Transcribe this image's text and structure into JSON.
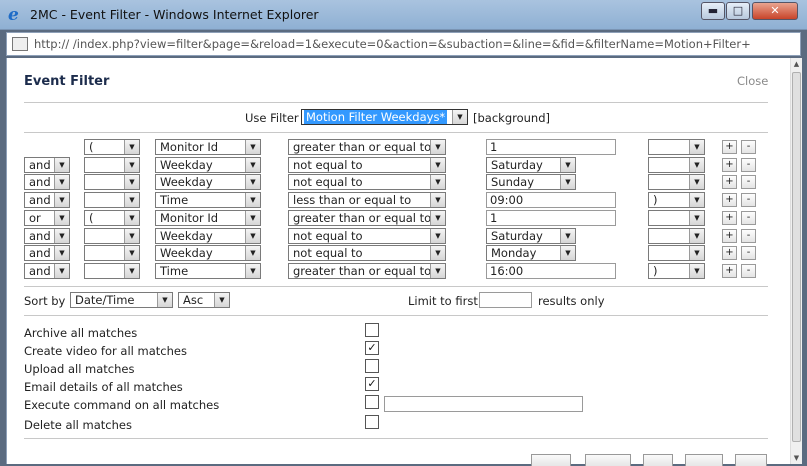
{
  "window": {
    "title": "2MC - Event Filter - Windows Internet Explorer",
    "min_glyph": "▬",
    "max_glyph": "□",
    "close_glyph": "✕",
    "url": "http://                    /index.php?view=filter&page=&reload=1&execute=0&action=&subaction=&line=&fid=&filterName=Motion+Filter+"
  },
  "header": {
    "title": "Event Filter",
    "close_label": "Close"
  },
  "use_filter": {
    "label": "Use Filter",
    "value": "Motion Filter Weekdays*",
    "background_label": "[background]"
  },
  "terms": [
    {
      "conj": "",
      "obr": "(",
      "attr": "Monitor Id",
      "op": "greater than or equal to",
      "val": "1",
      "val_type": "text",
      "cbr": ""
    },
    {
      "conj": "and",
      "obr": "",
      "attr": "Weekday",
      "op": "not equal to",
      "val": "Saturday",
      "val_type": "select",
      "cbr": ""
    },
    {
      "conj": "and",
      "obr": "",
      "attr": "Weekday",
      "op": "not equal to",
      "val": "Sunday",
      "val_type": "select",
      "cbr": ""
    },
    {
      "conj": "and",
      "obr": "",
      "attr": "Time",
      "op": "less than or equal to",
      "val": "09:00",
      "val_type": "text",
      "cbr": ")"
    },
    {
      "conj": "or",
      "obr": "(",
      "attr": "Monitor Id",
      "op": "greater than or equal to",
      "val": "1",
      "val_type": "text",
      "cbr": ""
    },
    {
      "conj": "and",
      "obr": "",
      "attr": "Weekday",
      "op": "not equal to",
      "val": "Saturday",
      "val_type": "select",
      "cbr": ""
    },
    {
      "conj": "and",
      "obr": "",
      "attr": "Weekday",
      "op": "not equal to",
      "val": "Monday",
      "val_type": "select",
      "cbr": ""
    },
    {
      "conj": "and",
      "obr": "",
      "attr": "Time",
      "op": "greater than or equal to",
      "val": "16:00",
      "val_type": "text",
      "cbr": ")"
    }
  ],
  "buttons": {
    "plus": "+",
    "minus": "-"
  },
  "sort": {
    "label": "Sort by",
    "field": "Date/Time",
    "direction": "Asc",
    "limit_label": "Limit to first",
    "limit_value": "",
    "results_label": "results only"
  },
  "actions": [
    {
      "label": "Archive all matches",
      "checked": false
    },
    {
      "label": "Create video for all matches",
      "checked": true
    },
    {
      "label": "Upload all matches",
      "checked": false
    },
    {
      "label": "Email details of all matches",
      "checked": true
    },
    {
      "label": "Execute command on all matches",
      "checked": false,
      "command": ""
    },
    {
      "label": "Delete all matches",
      "checked": false
    }
  ],
  "icons": {
    "browser": "ie-icon",
    "page": "page-icon",
    "dropdown": "dropdown-arrow-icon",
    "check": "✓"
  }
}
